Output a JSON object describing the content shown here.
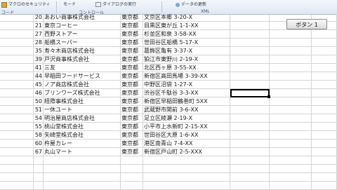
{
  "ribbon": {
    "security_label": "マクロのセキュリティ",
    "mode_label": "モード",
    "dialog_label": "ダイアログの実行",
    "update_label": "データの更新",
    "groups": [
      "コード",
      "コントロール",
      "XML"
    ]
  },
  "sheet_button": "ボタン 1",
  "rows": [
    {
      "num": "20",
      "name": "あおい商事株式会社",
      "pref": "東京都",
      "addr": "文京区本郷 3-20-X"
    },
    {
      "num": "21",
      "name": "東京コーヒー",
      "pref": "東京都",
      "addr": "目黒区東が丘 1-1-XX"
    },
    {
      "num": "27",
      "name": "西野ストアー",
      "pref": "東京都",
      "addr": "杉並区和泉 3-58-XX"
    },
    {
      "num": "28",
      "name": "船橋スーパー",
      "pref": "東京都",
      "addr": "世田谷区船橋 5-17-X"
    },
    {
      "num": "35",
      "name": "寿々木商店株式会社",
      "pref": "東京都",
      "addr": "葛飾区亀有 3-37-X"
    },
    {
      "num": "39",
      "name": "戸沢商事株式会社",
      "pref": "東京都",
      "addr": "狛江市東野川 2-19-X"
    },
    {
      "num": "41",
      "name": "三友",
      "pref": "東京都",
      "addr": "北区西ヶ原 3-55-XX"
    },
    {
      "num": "44",
      "name": "早稲田フードサービス",
      "pref": "東京都",
      "addr": "新宿区高田馬場 3-39-XX"
    },
    {
      "num": "45",
      "name": "ノア商店株式会社",
      "pref": "東京都",
      "addr": "中野区沼袋 1-27-X"
    },
    {
      "num": "46",
      "name": "ブリンワーズ株式会社",
      "pref": "東京都",
      "addr": "渋谷区千駄谷 3-3-XX"
    },
    {
      "num": "50",
      "name": "経際事株式会社",
      "pref": "東京都",
      "addr": "新宿区早稲田鶴巻町 5XX"
    },
    {
      "num": "51",
      "name": "一休ユート",
      "pref": "東京都",
      "addr": "武蔵野市関前 3-6-XX"
    },
    {
      "num": "54",
      "name": "明治屋商店株式会社",
      "pref": "東京都",
      "addr": "足立区綾瀬 2-19-X"
    },
    {
      "num": "55",
      "name": "桃山堂株式会社",
      "pref": "東京都",
      "addr": "小平市上水新町 2-15-XX"
    },
    {
      "num": "58",
      "name": "矢崎堂株式会社",
      "pref": "東京都",
      "addr": "世田谷区大原 1-6-XX"
    },
    {
      "num": "60",
      "name": "杵屋カレー",
      "pref": "東京都",
      "addr": "港区南青山 7-4-XX"
    },
    {
      "num": "67",
      "name": "丸山マート",
      "pref": "東京都",
      "addr": "新宿区戸山町 2-5-XXX"
    }
  ]
}
